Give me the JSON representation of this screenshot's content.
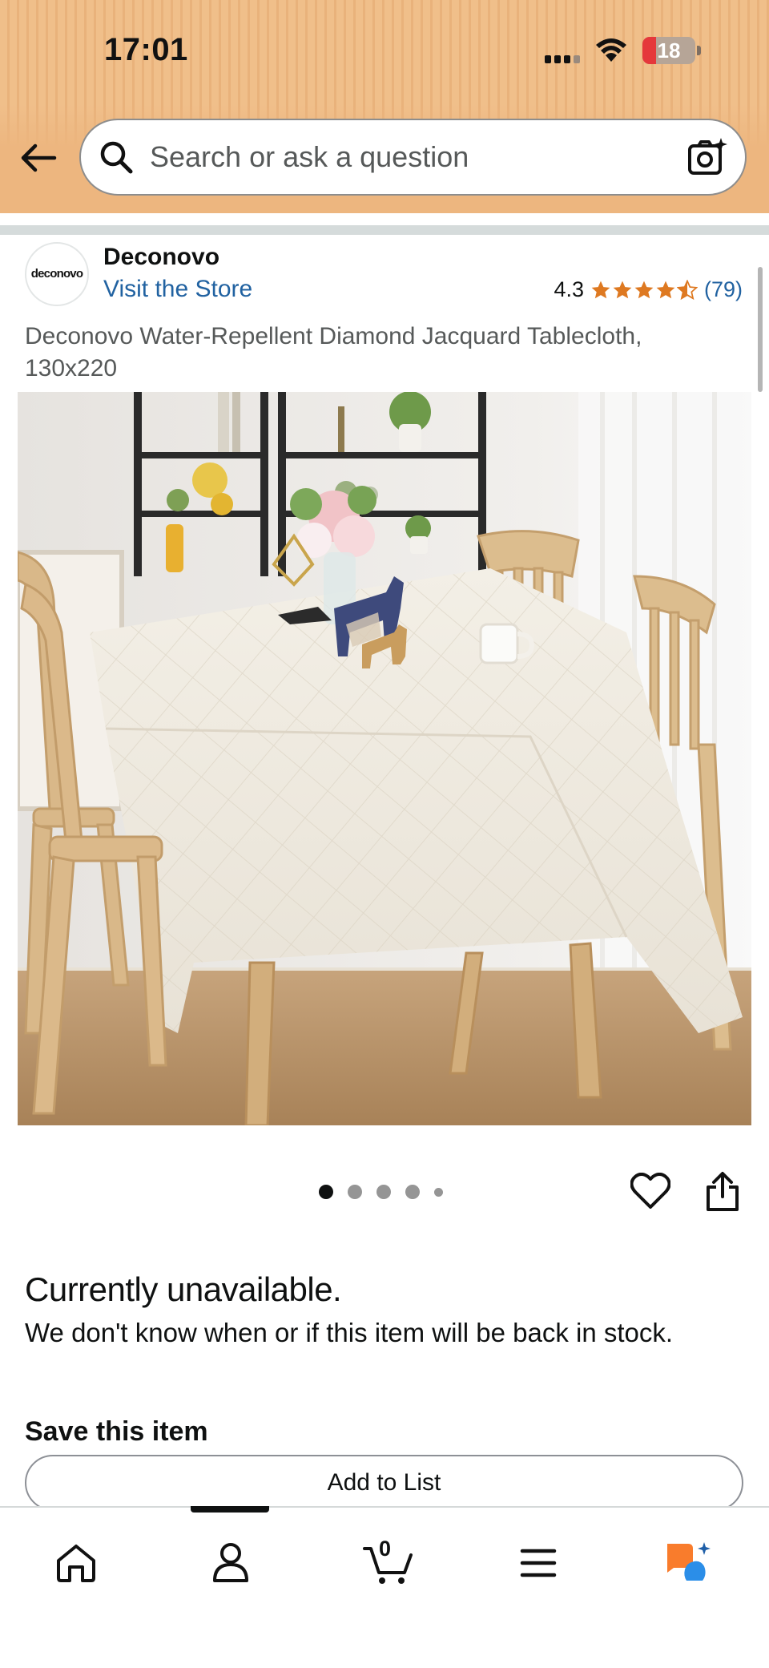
{
  "status_bar": {
    "time": "17:01",
    "battery_level": "18"
  },
  "search": {
    "placeholder": "Search or ask a question",
    "value": ""
  },
  "product": {
    "brand": "Deconovo",
    "logo_text": "deconovo",
    "store_link": "Visit the Store",
    "rating_value": "4.3",
    "rating_stars": 4.3,
    "rating_count": "(79)",
    "title": "Deconovo Water-Repellent Diamond Jacquard Tablecloth, 130x220"
  },
  "carousel": {
    "total": 5,
    "active_index": 0
  },
  "availability": {
    "title": "Currently unavailable.",
    "message": "We don't know when or if this item will be back in stock."
  },
  "save": {
    "title": "Save this item",
    "button_label": "Add to List"
  },
  "bottom_nav": {
    "cart_count": "0",
    "items": [
      "home-icon",
      "account-icon",
      "cart-icon",
      "menu-icon",
      "rufus-icon"
    ]
  },
  "colors": {
    "link": "#2162a1",
    "star": "#de7921",
    "header": "#edb67f",
    "rufus_orange": "#f97c2c",
    "rufus_blue": "#2b8ee8"
  }
}
